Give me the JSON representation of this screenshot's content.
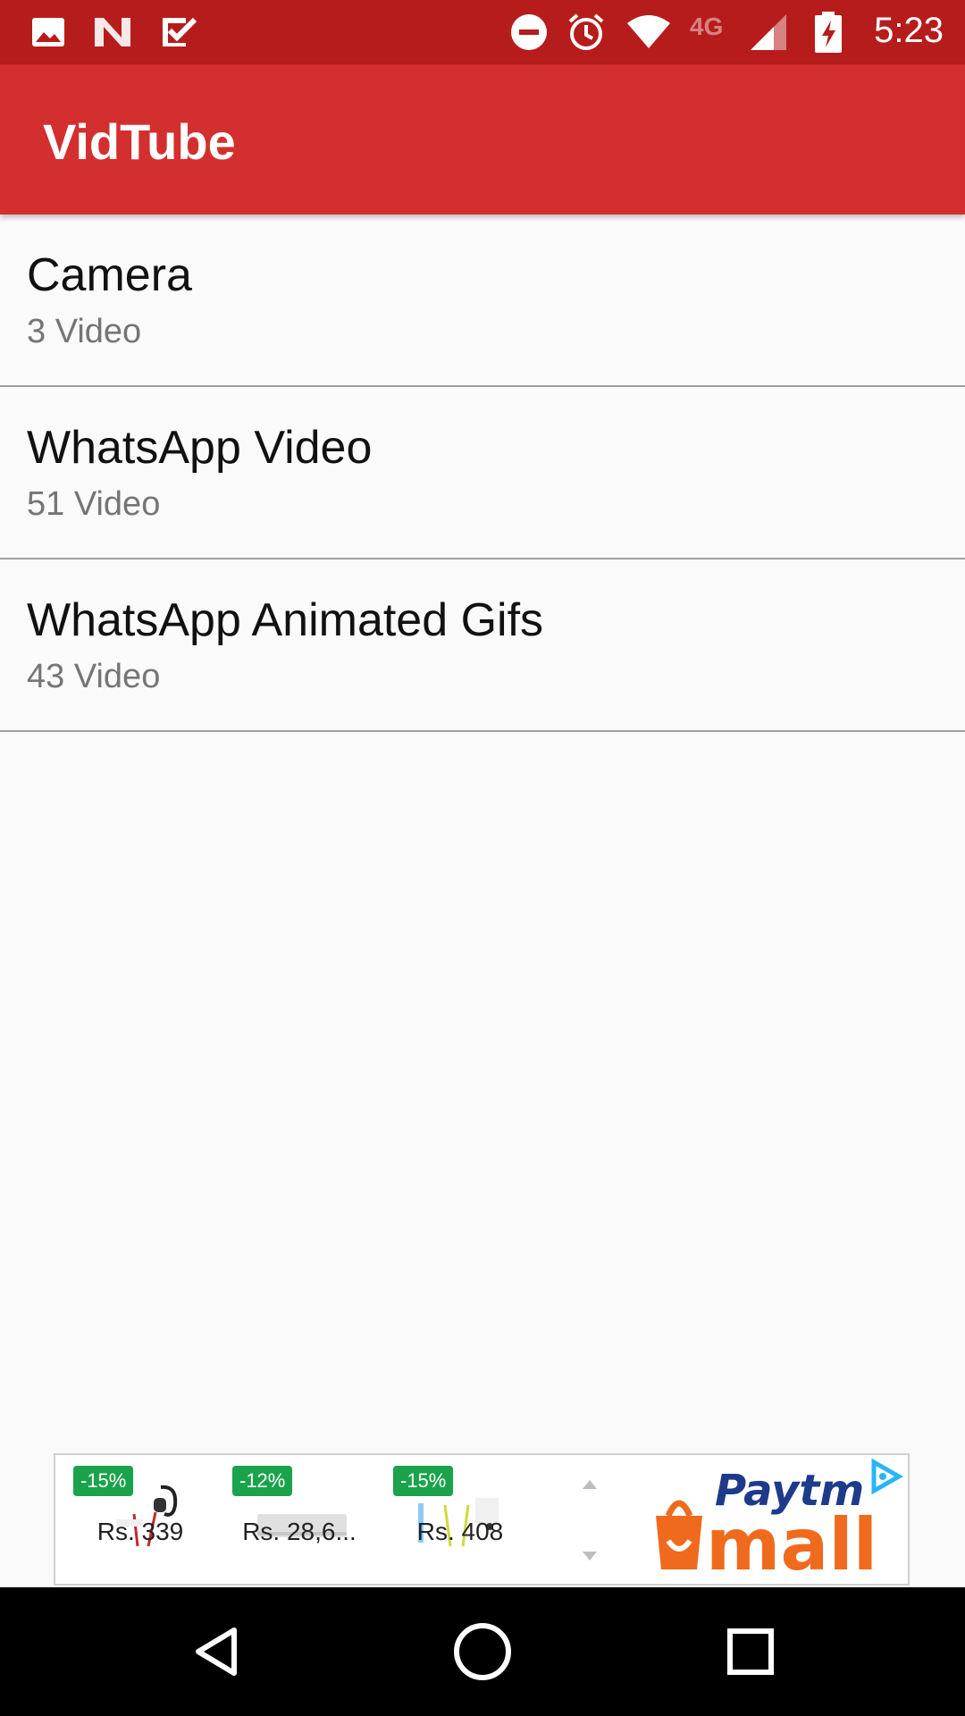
{
  "status_bar": {
    "time": "5:23",
    "network": "4G",
    "icons": [
      "image-icon",
      "n-app-icon",
      "check-app-icon",
      "dnd-icon",
      "alarm-icon",
      "wifi-icon",
      "signal-icon",
      "battery-charging-icon"
    ]
  },
  "app_bar": {
    "title": "VidTube",
    "background": "#d32f2f",
    "status_bar_color": "#b71c1c"
  },
  "folders": [
    {
      "name": "Camera",
      "count": "3 Video"
    },
    {
      "name": "WhatsApp Video",
      "count": "51 Video"
    },
    {
      "name": "WhatsApp Animated Gifs",
      "count": "43 Video"
    }
  ],
  "ad": {
    "products": [
      {
        "discount": "-15%",
        "price": "Rs. 339"
      },
      {
        "discount": "-12%",
        "price": "Rs. 28,6..."
      },
      {
        "discount": "-15%",
        "price": "Rs. 408"
      }
    ],
    "brand_top": "Paytm",
    "brand_bottom": "mall",
    "badge_color": "#1aa34a"
  },
  "nav_bar": {
    "icons": [
      "back-icon",
      "home-icon",
      "recents-icon"
    ]
  }
}
